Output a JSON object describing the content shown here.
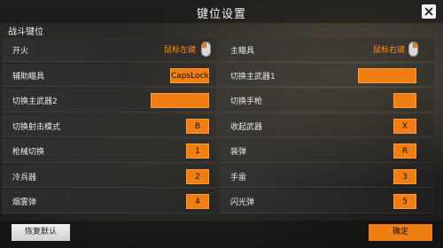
{
  "window": {
    "title": "键位设置"
  },
  "section": {
    "title": "战斗键位"
  },
  "left_rows": [
    {
      "label": "开火",
      "key": "鼠标左键",
      "type": "mouse"
    },
    {
      "label": "辅助瞄具",
      "key": "CapsLock",
      "type": "key"
    },
    {
      "label": "切换主武器2",
      "key": "",
      "type": "key"
    },
    {
      "label": "切换射击模式",
      "key": "B",
      "type": "key"
    },
    {
      "label": "枪械切换",
      "key": "1",
      "type": "key"
    },
    {
      "label": "冷兵器",
      "key": "2",
      "type": "key"
    },
    {
      "label": "烟雾弹",
      "key": "4",
      "type": "key"
    }
  ],
  "right_rows": [
    {
      "label": "主瞄具",
      "key": "鼠标右键",
      "type": "mouse"
    },
    {
      "label": "切换主武器1",
      "key": "",
      "type": "key"
    },
    {
      "label": "切换手枪",
      "key": "",
      "type": "key"
    },
    {
      "label": "收起武器",
      "key": "X",
      "type": "key"
    },
    {
      "label": "装弹",
      "key": "R",
      "type": "key"
    },
    {
      "label": "手雷",
      "key": "3",
      "type": "key"
    },
    {
      "label": "闪光弹",
      "key": "5",
      "type": "key"
    }
  ],
  "footer": {
    "reset_label": "恢复默认",
    "confirm_label": "确定"
  },
  "colors": {
    "accent": "#f07e12",
    "text": "#e6e6e6"
  }
}
